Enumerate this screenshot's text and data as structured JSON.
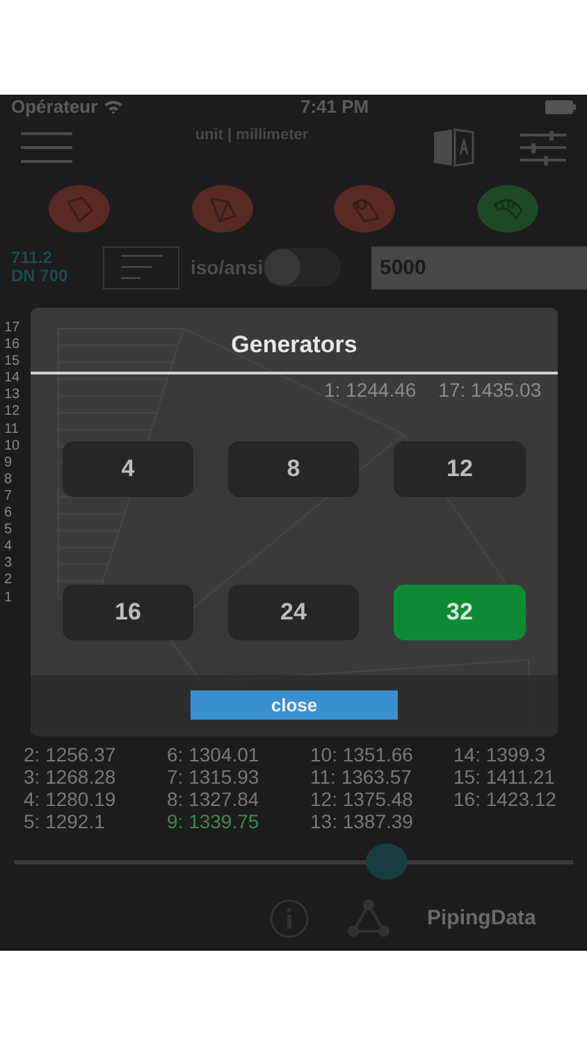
{
  "status_bar": {
    "carrier": "Opérateur",
    "time": "7:41 PM"
  },
  "nav": {
    "unit_label": "unit | millimeter"
  },
  "fitting_buttons": [
    {
      "color": "#5a2a25"
    },
    {
      "color": "#5a2a25"
    },
    {
      "color": "#5a2a25"
    },
    {
      "color": "#1f4a27"
    }
  ],
  "pipe_info": {
    "diameter": "711.2",
    "nominal": "DN 700"
  },
  "standard_switch": {
    "label": "iso/ansi",
    "on": false
  },
  "length_field": {
    "value": "5000"
  },
  "chart": {
    "segment_labels": [
      "17",
      "16",
      "15",
      "14",
      "13",
      "12",
      "11",
      "10",
      "9",
      "8",
      "7",
      "6",
      "5",
      "4",
      "3",
      "2",
      "1"
    ],
    "first_label": "1: 1244.46",
    "last_label": "17: 1435.03"
  },
  "legend": [
    {
      "text": "2: 1256.37",
      "highlighted": false
    },
    {
      "text": "3: 1268.28",
      "highlighted": false
    },
    {
      "text": "4: 1280.19",
      "highlighted": false
    },
    {
      "text": "5: 1292.1",
      "highlighted": false
    },
    {
      "text": "6: 1304.01",
      "highlighted": false
    },
    {
      "text": "7: 1315.93",
      "highlighted": false
    },
    {
      "text": "8: 1327.84",
      "highlighted": false
    },
    {
      "text": "9: 1339.75",
      "highlighted": true
    },
    {
      "text": "10: 1351.66",
      "highlighted": false
    },
    {
      "text": "11: 1363.57",
      "highlighted": false
    },
    {
      "text": "12: 1375.48",
      "highlighted": false
    },
    {
      "text": "13: 1387.39",
      "highlighted": false
    },
    {
      "text": "14: 1399.3",
      "highlighted": false
    },
    {
      "text": "15: 1411.21",
      "highlighted": false
    },
    {
      "text": "16: 1423.12",
      "highlighted": false
    }
  ],
  "slider": {
    "level": 0.667
  },
  "toolbar": {
    "app_name": "PipingData"
  },
  "dialog": {
    "title": "Generators",
    "options": [
      {
        "label": "4",
        "selected": false
      },
      {
        "label": "8",
        "selected": false
      },
      {
        "label": "12",
        "selected": false
      },
      {
        "label": "16",
        "selected": false
      },
      {
        "label": "24",
        "selected": false
      },
      {
        "label": "32",
        "selected": true
      }
    ],
    "close_label": "close"
  }
}
